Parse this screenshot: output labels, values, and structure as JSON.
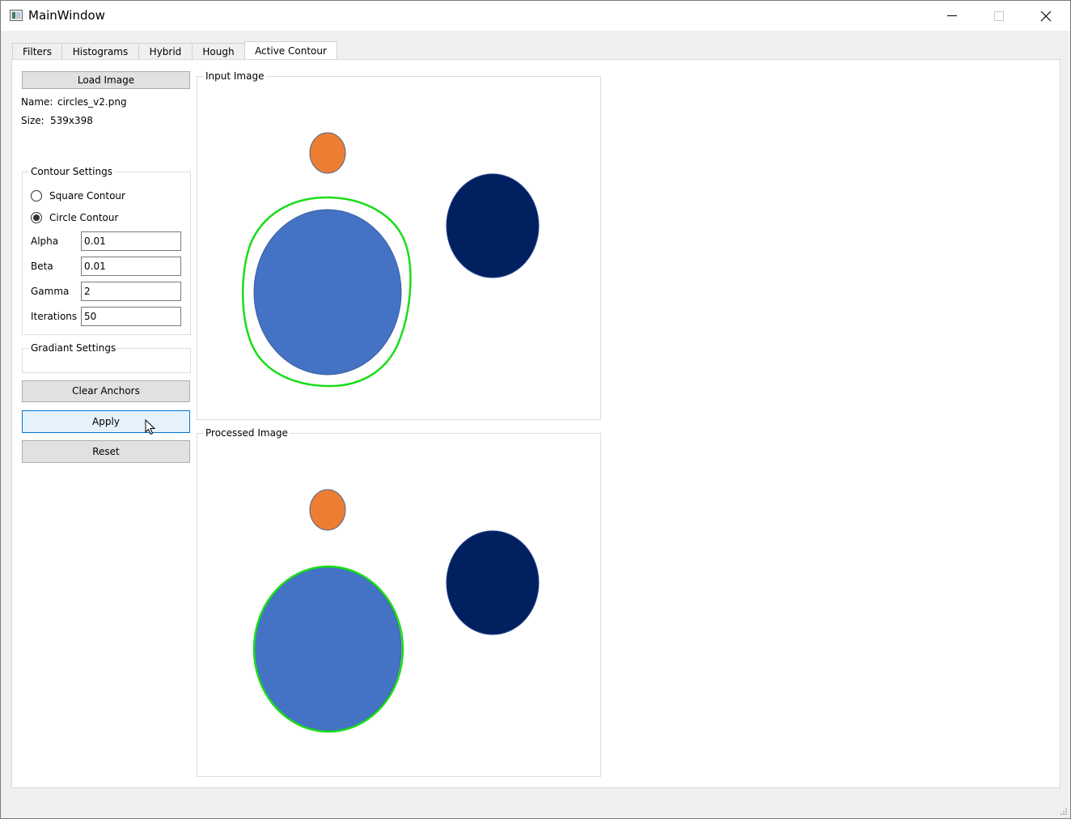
{
  "window": {
    "title": "MainWindow"
  },
  "tabs": [
    {
      "label": "Filters"
    },
    {
      "label": "Histograms"
    },
    {
      "label": "Hybrid"
    },
    {
      "label": "Hough"
    },
    {
      "label": "Active Contour",
      "active": true
    }
  ],
  "left": {
    "load_button": "Load Image",
    "name_label": "Name:",
    "name_value": "circles_v2.png",
    "size_label": "Size:",
    "size_value": "539x398",
    "contour_settings": {
      "title": "Contour Settings",
      "square_label": "Square Contour",
      "circle_label": "Circle Contour",
      "selected": "Circle Contour",
      "alpha_label": "Alpha",
      "alpha_value": "0.01",
      "beta_label": "Beta",
      "beta_value": "0.01",
      "gamma_label": "Gamma",
      "gamma_value": "2",
      "iterations_label": "Iterations",
      "iterations_value": "50"
    },
    "gradient_settings": {
      "title": "Gradiant Settings"
    },
    "clear_anchors_button": "Clear Anchors",
    "apply_button": "Apply",
    "reset_button": "Reset"
  },
  "images": {
    "input_title": "Input Image",
    "processed_title": "Processed Image"
  },
  "colors": {
    "orange_circle": "#ed7d31",
    "blue_circle": "#4472c4",
    "navy_circle": "#002060",
    "contour": "#1adc1a",
    "focus_border": "#0078d7"
  }
}
